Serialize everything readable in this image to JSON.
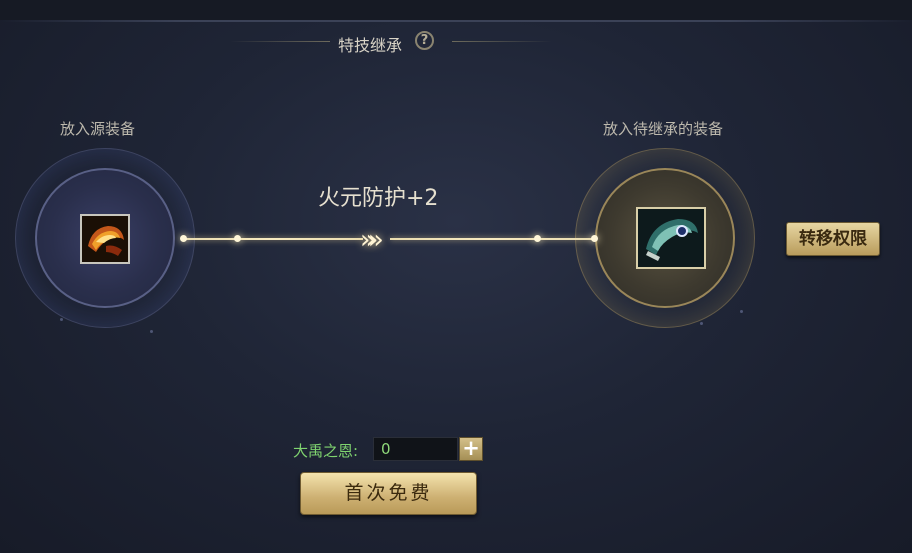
{
  "panel": {
    "title": "特技继承",
    "help_icon": "?"
  },
  "source_slot": {
    "label": "放入源装备",
    "item_icon": "fire-helmet-icon"
  },
  "target_slot": {
    "label": "放入待继承的装备",
    "item_icon": "jade-armor-icon"
  },
  "transfer": {
    "skill_text": "火元防护+2",
    "arrow_glyph": "»"
  },
  "actions": {
    "transfer_permission_label": "转移权限",
    "first_free_label": "首次免费"
  },
  "grace": {
    "label": "大禹之恩:",
    "value": "0",
    "plus_glyph": "+"
  },
  "colors": {
    "accent_gold": "#cdb072",
    "green_text": "#7fd36f"
  }
}
